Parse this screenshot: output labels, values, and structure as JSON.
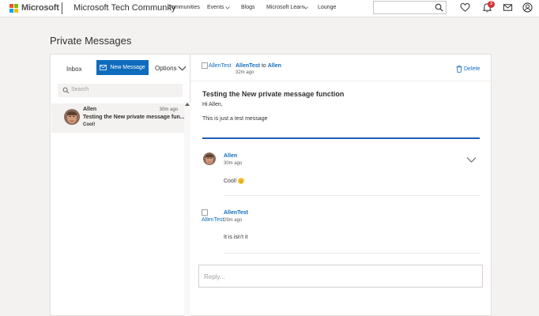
{
  "header": {
    "brand": "Microsoft",
    "site_title": "Microsoft Tech Community",
    "nav": [
      "Communities",
      "Events",
      "Blogs",
      "Microsoft Learn",
      "Lounge"
    ],
    "notification_count": "3"
  },
  "page": {
    "title": "Private Messages"
  },
  "sidebar": {
    "tab_inbox": "Inbox",
    "new_message_label": "New Message",
    "options_label": "Options",
    "search_placeholder": "Search",
    "conversation": {
      "name": "Allen",
      "time": "30m ago",
      "subject": "Testing the New private message fun...",
      "preview": "Cool!"
    }
  },
  "thread": {
    "avatar_alt": "AllenTest",
    "from": "AllenTest",
    "to_word": "to",
    "to": "Allen",
    "time": "32m ago",
    "delete_label": "Delete",
    "subject": "Testing the New private message function",
    "greeting": "Hi Allen,",
    "body": "This is just a test message",
    "replies": [
      {
        "name": "Allen",
        "time": "30m ago",
        "text": "Cool!"
      },
      {
        "avatar_alt": "AllenTest",
        "name": "AllenTest",
        "time": "29m ago",
        "text": "It is isn't it"
      }
    ],
    "reply_placeholder": "Reply..."
  }
}
